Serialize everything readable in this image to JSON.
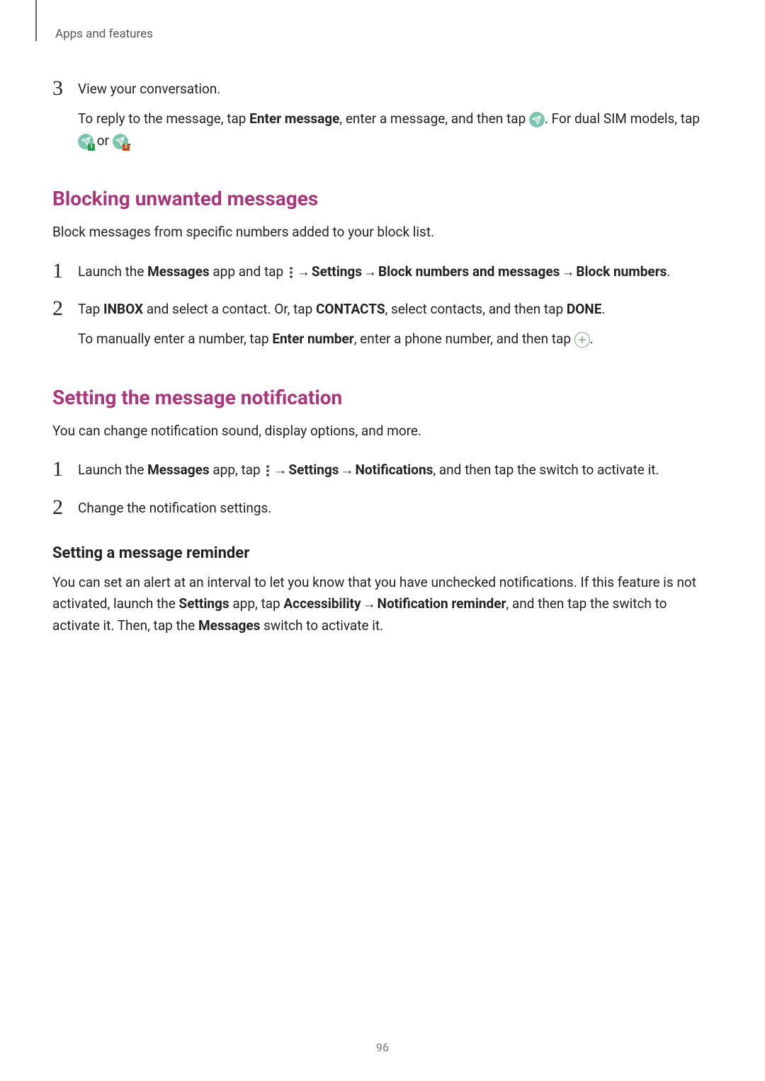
{
  "header": {
    "section": "Apps and features"
  },
  "step3": {
    "number": "3",
    "text": "View your conversation.",
    "sub_a": "To reply to the message, tap ",
    "sub_b": "Enter message",
    "sub_c": ", enter a message, and then tap ",
    "sub_d": ". For dual SIM models, tap ",
    "sub_e": " or ",
    "sub_f": "."
  },
  "blocking": {
    "heading": "Blocking unwanted messages",
    "desc": "Block messages from specific numbers added to your block list.",
    "step1": {
      "number": "1",
      "a": "Launch the ",
      "b": "Messages",
      "c": " app and tap ",
      "d": " → ",
      "e": "Settings",
      "f": " → ",
      "g": "Block numbers and messages",
      "h": " → ",
      "i": "Block numbers",
      "j": "."
    },
    "step2": {
      "number": "2",
      "a": "Tap ",
      "b": "INBOX",
      "c": " and select a contact. Or, tap ",
      "d": "CONTACTS",
      "e": ", select contacts, and then tap ",
      "f": "DONE",
      "g": ".",
      "sub_a": "To manually enter a number, tap ",
      "sub_b": "Enter number",
      "sub_c": ", enter a phone number, and then tap ",
      "sub_d": "."
    }
  },
  "notification": {
    "heading": "Setting the message notification",
    "desc": "You can change notification sound, display options, and more.",
    "step1": {
      "number": "1",
      "a": "Launch the ",
      "b": "Messages",
      "c": " app, tap ",
      "d": " → ",
      "e": "Settings",
      "f": " → ",
      "g": "Notifications",
      "h": ", and then tap the switch to activate it."
    },
    "step2": {
      "number": "2",
      "text": "Change the notification settings."
    }
  },
  "reminder": {
    "heading": "Setting a message reminder",
    "a": "You can set an alert at an interval to let you know that you have unchecked notifications. If this feature is not activated, launch the ",
    "b": "Settings",
    "c": " app, tap ",
    "d": "Accessibility",
    "e": " → ",
    "f": "Notification reminder",
    "g": ", and then tap the switch to activate it. Then, tap the ",
    "h": "Messages",
    "i": " switch to activate it."
  },
  "page_number": "96"
}
